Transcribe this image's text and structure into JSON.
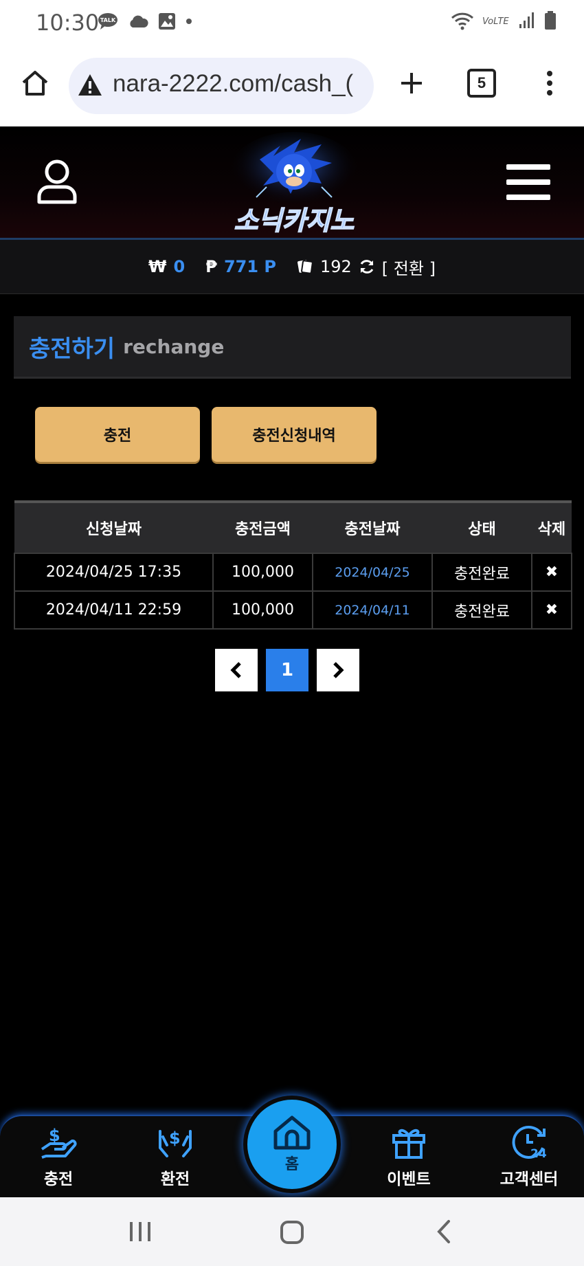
{
  "status_bar": {
    "time": "10:30",
    "talk_badge": "TALK",
    "volte": "VoLTE"
  },
  "browser": {
    "url": "nara-2222.com/cash_(",
    "tab_count": "5"
  },
  "site": {
    "logo_text": "소닉카지노",
    "balance": {
      "won_symbol": "₩",
      "won_value": "0",
      "point_symbol": "₱",
      "point_value": "771 P",
      "chip_value": "192",
      "convert_label": "[ 전환 ]"
    }
  },
  "section": {
    "title_kr": "충전하기",
    "title_en": "rechange"
  },
  "buttons": {
    "charge": "충전",
    "history": "충전신청내역"
  },
  "table": {
    "headers": [
      "신청날짜",
      "충전금액",
      "충전날짜",
      "상태",
      "삭제"
    ],
    "rows": [
      {
        "request_date": "2024/04/25 17:35",
        "amount": "100,000",
        "charge_date": "2024/04/25",
        "status": "충전완료",
        "delete": "✖"
      },
      {
        "request_date": "2024/04/11 22:59",
        "amount": "100,000",
        "charge_date": "2024/04/11",
        "status": "충전완료",
        "delete": "✖"
      }
    ]
  },
  "pagination": {
    "prev": "‹",
    "current": "1",
    "next": "›"
  },
  "bottom_nav": {
    "charge": "충전",
    "exchange": "환전",
    "home": "홈",
    "event": "이벤트",
    "support": "고객센터"
  },
  "icons": {
    "home": "home-icon",
    "warning": "warning-icon",
    "plus": "plus-icon",
    "menu": "more-vertical-icon",
    "user": "user-icon",
    "hamburger": "hamburger-menu-icon",
    "refresh": "refresh-icon",
    "chips": "chips-icon"
  },
  "colors": {
    "accent_blue": "#3a8ef0",
    "button_gold": "#e8b86e",
    "page_active": "#2a7fea"
  }
}
